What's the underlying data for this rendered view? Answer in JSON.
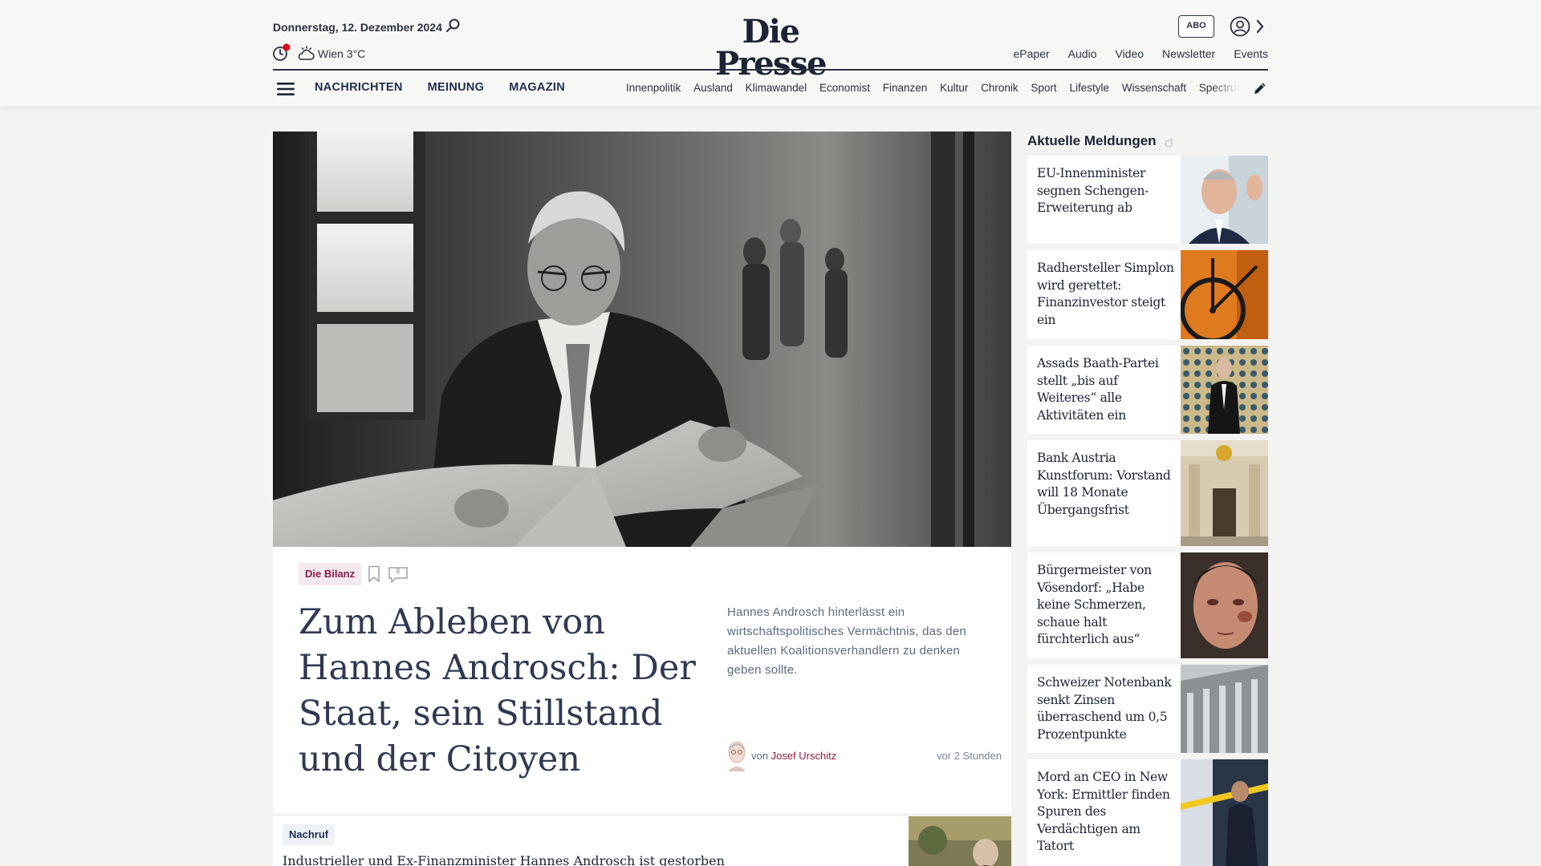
{
  "header": {
    "date": "Donnerstag, 12. Dezember 2024",
    "weather": "Wien 3°C",
    "logo": "Die Presse",
    "abo_label": "ABO",
    "top_links": [
      "ePaper",
      "Audio",
      "Video",
      "Newsletter",
      "Events"
    ],
    "main_nav": [
      "NACHRICHTEN",
      "MEINUNG",
      "MAGAZIN"
    ],
    "sub_nav": [
      "Innenpolitik",
      "Ausland",
      "Klimawandel",
      "Economist",
      "Finanzen",
      "Kultur",
      "Chronik",
      "Sport",
      "Lifestyle",
      "Wissenschaft",
      "Spectrum"
    ],
    "icons": [
      "search-icon",
      "timer-icon",
      "weather-icon",
      "user-icon",
      "chevron-right-icon",
      "menu-icon",
      "pencil-icon"
    ]
  },
  "hero": {
    "category": "Die Bilanz",
    "comment_count": "8",
    "headline": "Zum Ableben von Hannes Androsch: Der Staat, sein Stillstand und der Citoyen",
    "teaser": "Hannes Androsch hinterlässt ein wirtschaftspolitisches Vermächtnis, das den aktuellen Koalitionsverhandlern zu denken geben sollte.",
    "byline_prefix": "von",
    "author": "Josef Urschitz",
    "time": "vor 2 Stunden"
  },
  "second_article": {
    "category": "Nachruf",
    "title": "Industrieller und Ex-Finanzminister Hannes Androsch ist gestorben"
  },
  "sidebar": {
    "title": "Aktuelle Meldungen",
    "items": [
      {
        "title": "EU-Innenminister segnen Schengen-Erweiterung ab"
      },
      {
        "title": "Radhersteller Simplon wird gerettet: Finanzin­vestor steigt ein"
      },
      {
        "title": "Assads Baath-Partei stellt „bis auf Weiteres“ alle Aktivitäten ein"
      },
      {
        "title": "Bank Austria Kunstforum: Vorstand will 18 Monate Übergangsfrist"
      },
      {
        "title": "Bürgermeister von Vösendorf: „Habe keine Schmerzen, schaue halt fürchterlich aus“"
      },
      {
        "title": "Schweizer Notenbank senkt Zinsen überraschend um 0,5 Prozentpunkte"
      },
      {
        "title": "Mord an CEO in New York: Ermittler finden Spuren des Verdächtigen am Tatort"
      }
    ]
  },
  "colors": {
    "brand_navy": "#1b2334",
    "accent_burgundy": "#8d1d4a",
    "badge_bg": "#f3e9ee",
    "page_bg": "#f3f3f2",
    "live_dot": "#e3001b"
  }
}
